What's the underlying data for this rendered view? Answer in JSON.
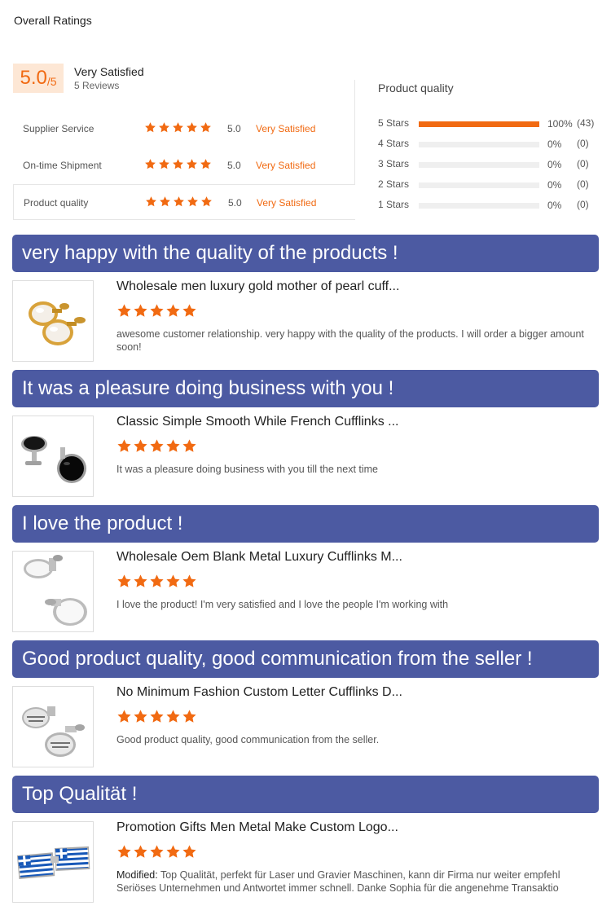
{
  "header": {
    "title": "Overall Ratings"
  },
  "overall": {
    "score": "5.0",
    "out_of": "/5",
    "label": "Very Satisfied",
    "reviews": "5 Reviews"
  },
  "metrics": [
    {
      "name": "Supplier Service",
      "score": "5.0",
      "label": "Very Satisfied",
      "rating": 5
    },
    {
      "name": "On-time Shipment",
      "score": "5.0",
      "label": "Very Satisfied",
      "rating": 5
    },
    {
      "name": "Product quality",
      "score": "5.0",
      "label": "Very Satisfied",
      "rating": 5
    }
  ],
  "distribution": {
    "title": "Product quality",
    "rows": [
      {
        "label": "5  Stars",
        "percent": "100%",
        "count": "(43)",
        "fill": 1.0
      },
      {
        "label": "4  Stars",
        "percent": "0%",
        "count": "(0)",
        "fill": 0
      },
      {
        "label": "3  Stars",
        "percent": "0%",
        "count": "(0)",
        "fill": 0
      },
      {
        "label": "2  Stars",
        "percent": "0%",
        "count": "(0)",
        "fill": 0
      },
      {
        "label": "1  Stars",
        "percent": "0%",
        "count": "(0)",
        "fill": 0
      }
    ]
  },
  "reviews": [
    {
      "headline": "very happy with the quality of the products !",
      "product": "Wholesale men luxury gold mother of pearl cuff...",
      "rating": 5,
      "text": "awesome customer relationship. very happy with the quality of the products. I will order a bigger amount soon!",
      "image": "gold-pearl-cufflinks"
    },
    {
      "headline": "It was a pleasure doing business with you !",
      "product": "Classic Simple Smooth While French Cufflinks ...",
      "rating": 5,
      "text": "It was a pleasure doing business with you till the next time",
      "image": "black-round-cufflinks"
    },
    {
      "headline": "I love the product !",
      "product": "Wholesale Oem Blank Metal Luxury Cufflinks M...",
      "rating": 5,
      "text": "I love the product! I'm very satisfied and I love the people I'm working with",
      "image": "silver-pearl-cufflinks"
    },
    {
      "headline": "Good product quality, good communication from the seller !",
      "product": "No Minimum Fashion Custom Letter Cufflinks D...",
      "rating": 5,
      "text": "Good product quality, good communication from the seller.",
      "image": "letter-cufflinks"
    },
    {
      "headline": "Top Qualität !",
      "product": "Promotion Gifts Men Metal Make Custom Logo...",
      "rating": 5,
      "modified_label": "Modified:",
      "text_line1": "Top Qualität, perfekt für Laser und Gravier Maschinen, kann dir Firma nur weiter empfehl",
      "text_line2": "Seriöses Unternehmen und Antwortet immer schnell. Danke Sophia für die angenehme Transaktio",
      "image": "greek-flag-cufflinks"
    }
  ],
  "colors": {
    "accent": "#f16a12",
    "banner": "#4c5aa2",
    "score_bg": "#fde7d5"
  }
}
